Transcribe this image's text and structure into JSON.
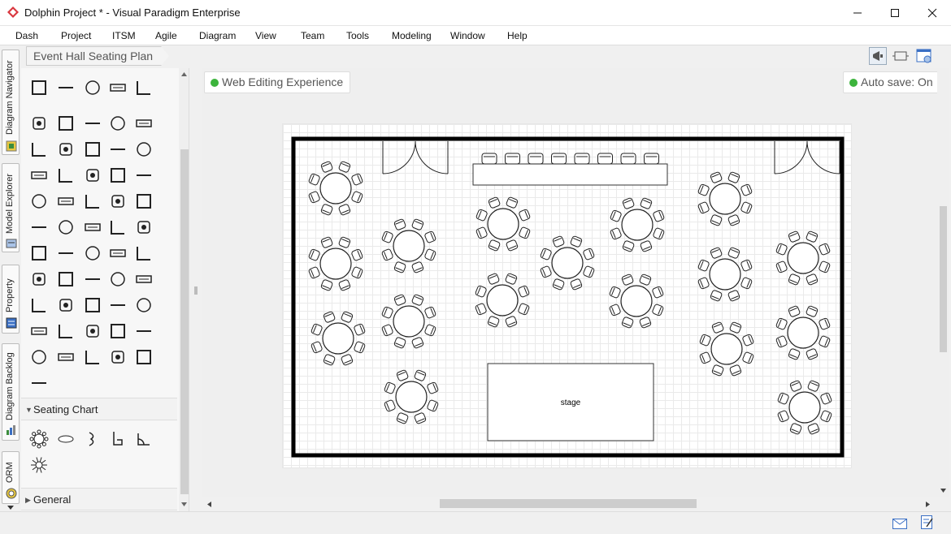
{
  "window": {
    "title": "Dolphin Project * - Visual Paradigm Enterprise"
  },
  "menu": [
    "Dash",
    "Project",
    "ITSM",
    "Agile",
    "Diagram",
    "View",
    "Team",
    "Tools",
    "Modeling",
    "Window",
    "Help"
  ],
  "side_tabs": [
    "Diagram Navigator",
    "Model Explorer",
    "Property",
    "Diagram Backlog",
    "ORM"
  ],
  "breadcrumb": {
    "label": "Event Hall Seating Plan"
  },
  "chips": {
    "web_editing": "Web Editing Experience",
    "auto_save": "Auto save: On"
  },
  "palette": {
    "sections": {
      "seating_chart": "Seating Chart",
      "general": "General"
    }
  },
  "diagram": {
    "stage_label": "stage"
  },
  "colors": {
    "status_green": "#3cb43c",
    "app_red": "#d9363e"
  }
}
